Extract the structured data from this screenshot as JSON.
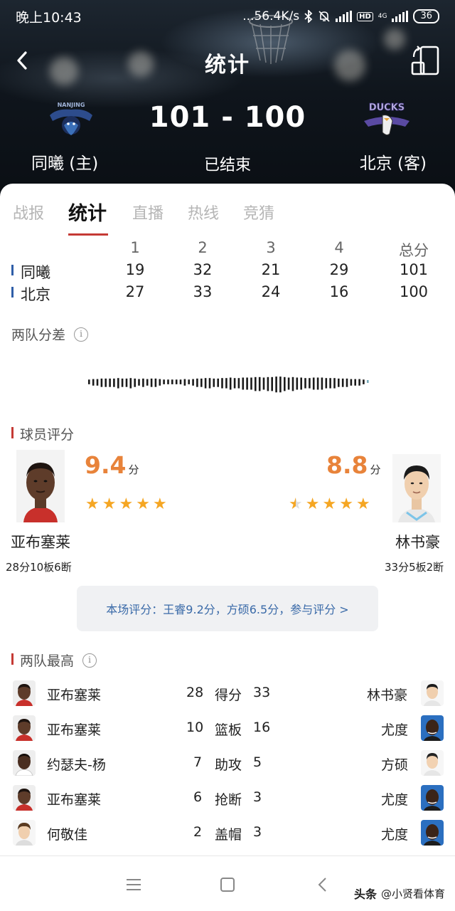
{
  "status_bar": {
    "time": "晚上10:43",
    "network_speed": "...56.4K/s",
    "battery": "36",
    "hd_label": "HD",
    "network_type": "4G"
  },
  "header": {
    "title": "统计",
    "score": "101 - 100",
    "game_status": "已结束",
    "home_team": "同曦 (主)",
    "away_team": "北京 (客)",
    "home_logo_text": "NANJING",
    "away_logo_text": "DUCKS"
  },
  "tabs": [
    {
      "label": "战报",
      "active": false
    },
    {
      "label": "统计",
      "active": true
    },
    {
      "label": "直播",
      "active": false
    },
    {
      "label": "热线",
      "active": false
    },
    {
      "label": "竞猜",
      "active": false
    }
  ],
  "quarters": {
    "headers": [
      "1",
      "2",
      "3",
      "4",
      "总分"
    ],
    "teams": [
      {
        "name": "同曦",
        "scores": [
          "19",
          "32",
          "21",
          "29",
          "101"
        ]
      },
      {
        "name": "北京",
        "scores": [
          "27",
          "33",
          "24",
          "16",
          "100"
        ]
      }
    ]
  },
  "score_diff": {
    "label": "两队分差",
    "values": [
      1,
      2,
      2,
      3,
      3,
      3,
      3,
      4,
      3,
      3,
      4,
      3,
      2,
      3,
      2,
      3,
      3,
      2,
      1,
      1,
      1,
      1,
      1,
      2,
      1,
      2,
      3,
      3,
      4,
      4,
      3,
      3,
      4,
      4,
      5,
      4,
      4,
      5,
      5,
      5,
      6,
      6,
      5,
      6,
      6,
      7,
      7,
      6,
      5,
      6,
      5,
      5,
      4,
      4,
      5,
      5,
      5,
      4,
      4,
      4,
      3,
      3,
      3,
      2,
      2,
      2,
      1,
      0
    ]
  },
  "player_ratings": {
    "label": "球员评分",
    "home": {
      "name": "亚布塞莱",
      "score": "9.4",
      "unit": "分",
      "stars": 5,
      "stats": "28分10板6断"
    },
    "away": {
      "name": "林书豪",
      "score": "8.8",
      "unit": "分",
      "stars": 4.5,
      "stats": "33分5板2断"
    },
    "summary": "本场评分：王睿9.2分，方硕6.5分，参与评分 >"
  },
  "leaders": {
    "label": "两队最高",
    "rows": [
      {
        "home_player": "亚布塞莱",
        "home_value": "28",
        "category": "得分",
        "away_value": "33",
        "away_player": "林书豪"
      },
      {
        "home_player": "亚布塞莱",
        "home_value": "10",
        "category": "篮板",
        "away_value": "16",
        "away_player": "尤度"
      },
      {
        "home_player": "约瑟夫-杨",
        "home_value": "7",
        "category": "助攻",
        "away_value": "5",
        "away_player": "方硕"
      },
      {
        "home_player": "亚布塞莱",
        "home_value": "6",
        "category": "抢断",
        "away_value": "3",
        "away_player": "尤度"
      },
      {
        "home_player": "何敬佳",
        "home_value": "2",
        "category": "盖帽",
        "away_value": "3",
        "away_player": "尤度"
      }
    ]
  },
  "watermark": {
    "source": "头条",
    "handle": "@小贤看体育"
  },
  "colors": {
    "accent": "#c53a35",
    "rating": "#e8833a",
    "star": "#f5a623",
    "link": "#3a6aa8",
    "team_bar": "#2f5ea8"
  }
}
